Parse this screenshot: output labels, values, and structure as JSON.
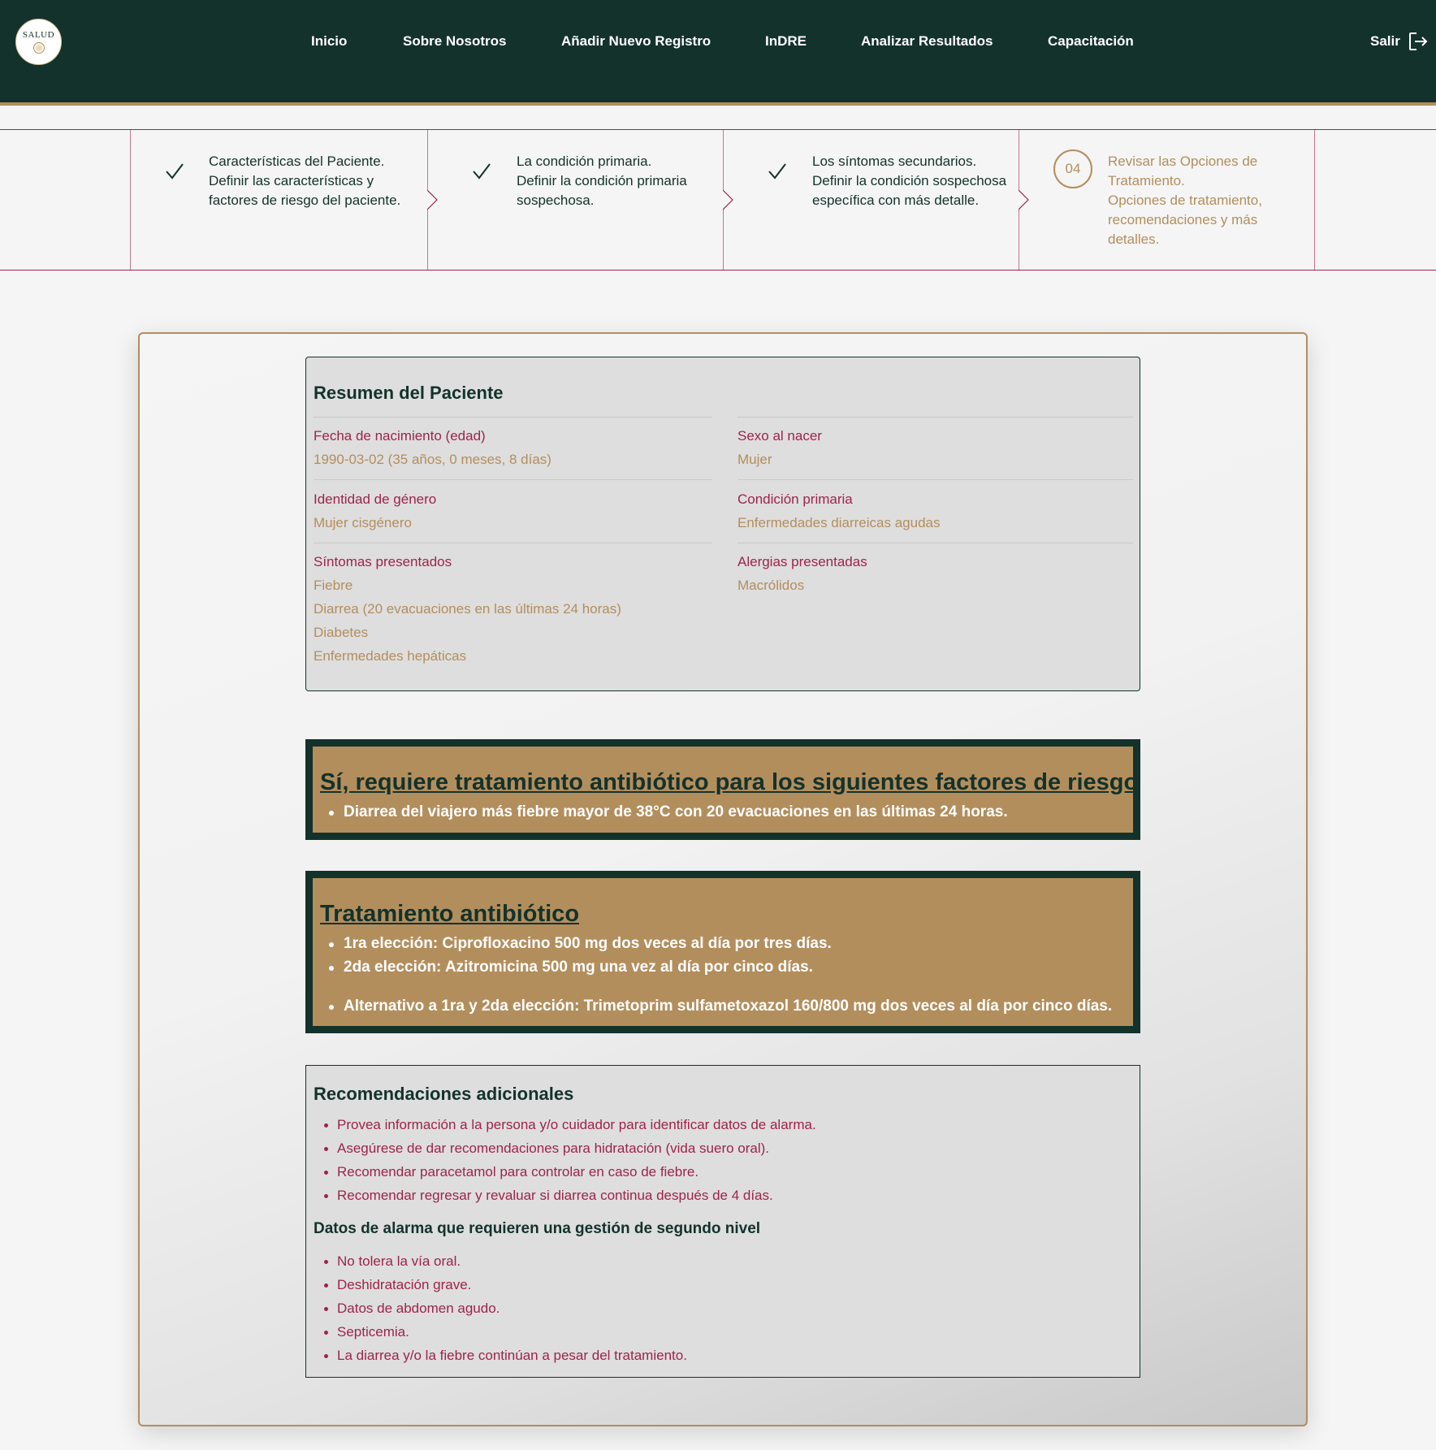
{
  "logo": {
    "text": "SALUD"
  },
  "nav": {
    "items": [
      "Inicio",
      "Sobre Nosotros",
      "Añadir Nuevo Registro",
      "InDRE",
      "Analizar Resultados",
      "Capacitación"
    ],
    "logout_label": "Salir"
  },
  "stepper": {
    "steps": [
      {
        "title": "Características del Paciente.",
        "desc": "Definir las características y factores de riesgo del paciente.",
        "status": "complete"
      },
      {
        "title": "La condición primaria.",
        "desc": "Definir la condición primaria sospechosa.",
        "status": "complete"
      },
      {
        "title": "Los síntomas secundarios.",
        "desc": "Definir la condición sospechosa específica con más detalle.",
        "status": "complete"
      },
      {
        "number": "04",
        "title": "Revisar las Opciones de Tratamiento.",
        "desc": "Opciones de tratamiento, recomendaciones y más detalles.",
        "status": "active"
      }
    ]
  },
  "summary": {
    "title": "Resumen del Paciente",
    "birth_label": "Fecha de nacimiento (edad)",
    "birth_value": "1990-03-02 (35 años, 0 meses, 8 días)",
    "sex_label": "Sexo al nacer",
    "sex_value": "Mujer",
    "gender_label": "Identidad de género",
    "gender_value": "Mujer cisgénero",
    "condition_label": "Condición primaria",
    "condition_value": "Enfermedades diarreicas agudas",
    "symptoms_label": "Síntomas presentados",
    "symptoms": [
      "Fiebre",
      "Diarrea (20 evacuaciones en las últimas 24 horas)",
      "Diabetes",
      "Enfermedades hepáticas"
    ],
    "allergies_label": "Alergias presentadas",
    "allergies": [
      "Macrólidos"
    ]
  },
  "risk": {
    "title": "Sí, requiere tratamiento antibiótico para los siguientes factores de riesgo",
    "items": [
      "Diarrea del viajero más fiebre mayor de 38°C con 20 evacuaciones en las últimas 24 horas."
    ]
  },
  "treatment": {
    "title": "Tratamiento antibiótico",
    "items": [
      "1ra elección: Ciprofloxacino 500 mg dos veces al día por tres días.",
      "2da elección: Azitromicina 500 mg una vez al día por cinco días.",
      "Alternativo a 1ra y 2da elección: Trimetoprim sulfametoxazol 160/800 mg dos veces al día por cinco días."
    ]
  },
  "recommendations": {
    "title": "Recomendaciones adicionales",
    "items": [
      "Provea información a la persona y/o cuidador para identificar datos de alarma.",
      "Asegúrese de dar recomendaciones para hidratación (vida suero oral).",
      "Recomendar paracetamol para controlar en caso de fiebre.",
      "Recomendar regresar y revaluar si diarrea continua después de 4 días."
    ]
  },
  "alarms": {
    "title": "Datos de alarma que requieren una gestión de segundo nivel",
    "items": [
      "No tolera la vía oral.",
      "Deshidratación grave.",
      "Datos de abdomen agudo.",
      "Septicemia.",
      "La diarrea y/o la fiebre continúan a pesar del tratamiento."
    ]
  },
  "colors": {
    "primary": "#13322b",
    "accent": "#b38e5d",
    "wine": "#9d2449",
    "background": "#f5f5f5"
  }
}
